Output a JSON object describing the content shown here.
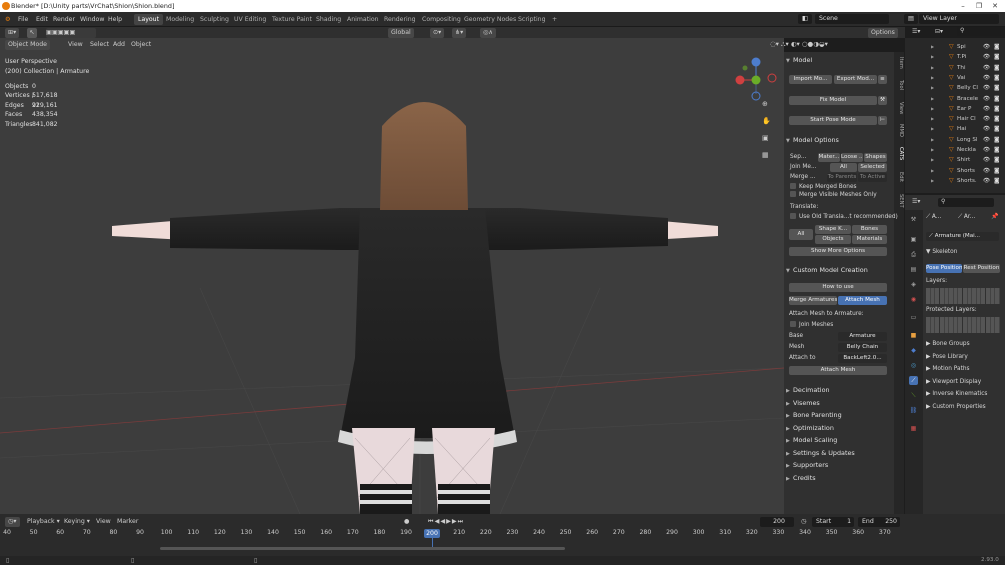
{
  "window": {
    "title": "Blender* [D:\\Unity parts\\VrChat\\Shion\\Shion.blend]"
  },
  "menu": [
    "File",
    "Edit",
    "Render",
    "Window",
    "Help"
  ],
  "workspaces": [
    "Layout",
    "Modeling",
    "Sculpting",
    "UV Editing",
    "Texture Paint",
    "Shading",
    "Animation",
    "Rendering",
    "Compositing",
    "Geometry Nodes",
    "Scripting"
  ],
  "active_workspace": "Layout",
  "scene": "Scene",
  "view_layer": "View Layer",
  "viewport": {
    "mode": "Object Mode",
    "menus": [
      "View",
      "Select",
      "Add",
      "Object"
    ],
    "transform": "Global",
    "options": "Options",
    "perspective": "User Perspective",
    "collection": "(200) Collection | Armature",
    "stats": [
      {
        "k": "Objects",
        "v": "0 / 22"
      },
      {
        "k": "Vertices",
        "v": "517,618"
      },
      {
        "k": "Edges",
        "v": "919,161"
      },
      {
        "k": "Faces",
        "v": "438,354"
      },
      {
        "k": "Triangles",
        "v": "841,082"
      }
    ]
  },
  "gizmo": {
    "x": "X",
    "y": "Y",
    "z": "Z"
  },
  "npanel": {
    "tabs": [
      "Item",
      "Tool",
      "View",
      "MMD",
      "CATS",
      "Edit",
      "SENT"
    ],
    "model": {
      "title": "Model",
      "import": "Import Mo...",
      "export": "Export Mod...",
      "fix": "Fix Model",
      "pose": "Start Pose Mode"
    },
    "options": {
      "title": "Model Options",
      "sep": "Sep...",
      "sep_opts": [
        "Mater...",
        "Loose ...",
        "Shapes"
      ],
      "join": "Join Me...",
      "join_opts": [
        "All",
        "Selected"
      ],
      "merge": "Merge ...",
      "merge_opts": [
        "To Parents",
        "To Active"
      ],
      "keep": "Keep Merged Bones",
      "merge_visible": "Merge Visible Meshes Only",
      "translate": "Translate:",
      "old_translate": "Use Old Transla...t recommended)",
      "all": "All",
      "shape": "Shape K...",
      "bones": "Bones",
      "objects": "Objects",
      "materials": "Materials",
      "more": "Show More Options"
    },
    "custom": {
      "title": "Custom Model Creation",
      "how": "How to use",
      "merge_arm": "Merge Armatures",
      "attach_mesh_tab": "Attach Mesh",
      "attach_to": "Attach Mesh to Armature:",
      "join": "Join Meshes",
      "base_label": "Base",
      "base_val": "Armature",
      "mesh_label": "Mesh",
      "mesh_val": "Belly Chain",
      "attach_label": "Attach to",
      "attach_val": "BackLeft2.0...",
      "attach_btn": "Attach Mesh"
    },
    "collapsed": [
      "Decimation",
      "Visemes",
      "Bone Parenting",
      "Optimization",
      "Model Scaling",
      "Settings & Updates",
      "Supporters",
      "Credits"
    ]
  },
  "outliner": {
    "rows": [
      "Spi",
      "T.Pi",
      "Thi",
      "Vai",
      "Belly Cl",
      "Bracele",
      "Ear P",
      "Hair Cl",
      "Hai",
      "Long Sl",
      "Neckla",
      "Shirt",
      "Shorts",
      "Shorts."
    ]
  },
  "properties": {
    "search": "",
    "obj1": "A...",
    "obj2": "Ar...",
    "armature": "Armature (Mai...",
    "skeleton": "Skeleton",
    "pose_pos": "Pose Position",
    "rest_pos": "Rest Position",
    "layers": "Layers:",
    "prot_layers": "Protected Layers:",
    "sections": [
      "Bone Groups",
      "Pose Library",
      "Motion Paths",
      "Viewport Display",
      "Inverse Kinematics",
      "Custom Properties"
    ]
  },
  "timeline": {
    "menus": [
      "Playback",
      "Keying",
      "View",
      "Marker"
    ],
    "current": "200",
    "start_label": "Start",
    "start": "1",
    "end_label": "End",
    "end": "250",
    "ticks": [
      "40",
      "50",
      "60",
      "70",
      "80",
      "90",
      "100",
      "110",
      "120",
      "130",
      "140",
      "150",
      "160",
      "170",
      "180",
      "190",
      "200",
      "210",
      "220",
      "230",
      "240",
      "250",
      "260",
      "270",
      "280",
      "290",
      "300",
      "310",
      "320",
      "330",
      "340",
      "350",
      "360",
      "370"
    ]
  },
  "version": "2.93.0",
  "colors": {
    "accent": "#4772b3",
    "orange": "#e87d0d"
  }
}
